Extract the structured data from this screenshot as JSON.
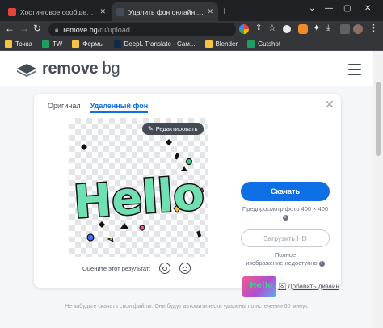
{
  "browser": {
    "tabs": [
      {
        "title": "Хостинговое сообщество «Tim",
        "favicon_color": "#e8413c",
        "active": false
      },
      {
        "title": "Удалить фон онлайн, сделать",
        "favicon_color": "#454b55",
        "active": true
      }
    ],
    "new_tab_label": "+",
    "window_controls": [
      "⌄",
      "—",
      "▢",
      "✕"
    ],
    "address": {
      "domain": "remove.bg",
      "path": "/ru/upload"
    },
    "bookmarks": [
      {
        "label": "Точка",
        "icon": "folder-icon"
      },
      {
        "label": "TW",
        "icon": "tw-icon",
        "color": "#1f9e63"
      },
      {
        "label": "Фермы",
        "icon": "folder-icon"
      },
      {
        "label": "DeepL Translate - Сам...",
        "icon": "deepl-icon",
        "color": "#0f2b46"
      },
      {
        "label": "Blender",
        "icon": "folder-icon"
      },
      {
        "label": "Gutshot",
        "icon": "gutshot-icon",
        "color": "#1f9e63"
      }
    ]
  },
  "site": {
    "logo": {
      "primary": "remove",
      "secondary": "bg"
    },
    "tabs": {
      "original": "Оригинал",
      "removed": "Удаленный фон"
    },
    "edit_button": "Редактировать",
    "hello_text": "Hello",
    "rate_prompt": "Оцените этот результат:",
    "download_button": "Скачать",
    "download_note": "Предпросмотр фото 400 × 400",
    "hd_button": "Загрузить HD",
    "hd_note_line1": "Полное",
    "hd_note_line2": "изображение недоступно",
    "design_thumb_text": "Hello",
    "design_link": "Добавить дизайн",
    "footer_note": "Не забудьте скачать свои файлы. Они будут автоматически удалены по истечении 60 минут.",
    "colors": {
      "accent": "#0f70e6",
      "text": "#454b55",
      "hello_fill": "#6fe0b2",
      "hello_stroke": "#111111"
    }
  }
}
